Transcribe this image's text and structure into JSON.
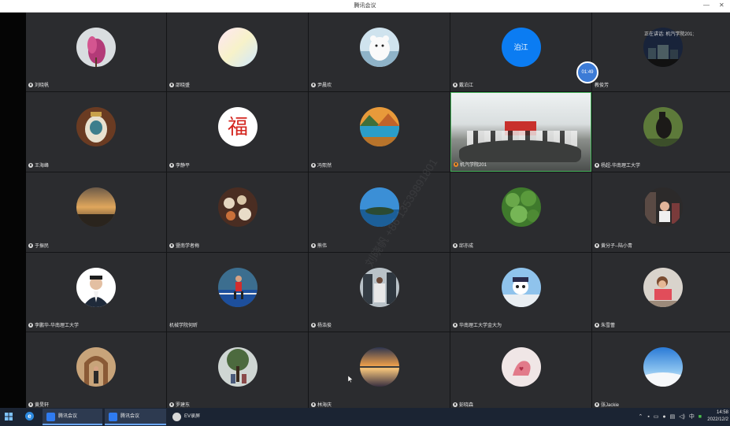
{
  "window": {
    "title": "腾讯会议"
  },
  "tiles": [
    {
      "name": "刘晓帆",
      "avatar": "magnolia-photo",
      "mic": "gray"
    },
    {
      "name": "邵晓盛",
      "avatar": "pastel-gradient",
      "mic": "gray"
    },
    {
      "name": "尹晨欢",
      "avatar": "white-bear-illustration",
      "mic": "gray"
    },
    {
      "name": "戴泊江",
      "avatar_text": "泊江",
      "avatar": "blue-initials",
      "mic": "gray"
    },
    {
      "name": "教俊芳",
      "avatar": "night-town-photo",
      "mic": "none"
    },
    {
      "name": "王海峰",
      "avatar": "vase-photo",
      "mic": "gray"
    },
    {
      "name": "李静平",
      "avatar": "fu-character",
      "mic": "gray"
    },
    {
      "name": "冯熙然",
      "avatar": "autumn-lake-photo",
      "mic": "gray"
    },
    {
      "name": "机汽学院201",
      "avatar": "meeting-room-video",
      "mic": "orange"
    },
    {
      "name": "杨超-华南理工大学",
      "avatar": "horse-photo",
      "mic": "gray"
    },
    {
      "name": "于振民",
      "avatar": "sunset-photo",
      "mic": "gray"
    },
    {
      "name": "暨南学者梅",
      "avatar": "tea-photo",
      "mic": "gray"
    },
    {
      "name": "熊伟",
      "avatar": "lake-island-photo",
      "mic": "gray"
    },
    {
      "name": "邱亦成",
      "avatar": "lotus-leaves-photo",
      "mic": "gray"
    },
    {
      "name": "黄分子--陆小青",
      "avatar": "child-photo",
      "mic": "gray"
    },
    {
      "name": "李鹏华-华南理工大学",
      "avatar": "portrait-photo",
      "mic": "gray"
    },
    {
      "name": "机械学院何昕",
      "avatar": "runner-photo",
      "mic": "none"
    },
    {
      "name": "杨浩俊",
      "avatar": "building-photo",
      "mic": "gray"
    },
    {
      "name": "华南理工大学金大为",
      "avatar": "cartoon-character",
      "mic": "gray"
    },
    {
      "name": "朱雪蕾",
      "avatar": "kid-sea-photo",
      "mic": "gray"
    },
    {
      "name": "黄旻轩",
      "avatar": "arch-photo",
      "mic": "gray"
    },
    {
      "name": "罗建东",
      "avatar": "tree-photo",
      "mic": "gray"
    },
    {
      "name": "林海庆",
      "avatar": "river-sunset-photo",
      "mic": "gray"
    },
    {
      "name": "彭晓森",
      "avatar": "pink-hand-photo",
      "mic": "gray"
    },
    {
      "name": "张Jackie",
      "avatar": "snow-sky-photo",
      "mic": "gray"
    }
  ],
  "overlay": {
    "timer": "01:49",
    "speaking_label": "正在讲话: 机汽学院201;",
    "watermark": "刘晓帆 +86 13539891801"
  },
  "taskbar": {
    "items": [
      "腾讯会议",
      "腾讯会议",
      "EV录屏"
    ],
    "tray_text": "中",
    "time": "14:58",
    "date": "2022/12/2"
  }
}
